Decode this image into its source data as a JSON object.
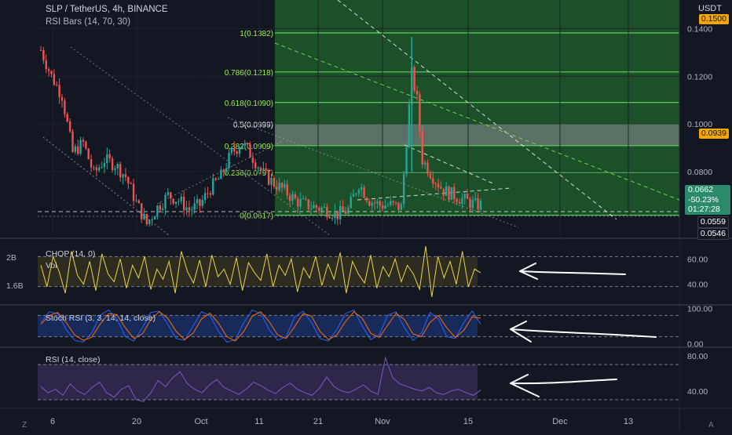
{
  "header": {
    "title": "SLP / TetherUS, 4h, BINANCE",
    "indicator": "RSI Bars (14, 70, 30)",
    "currency": "USDT"
  },
  "footer": {
    "left": "Z",
    "right": "A"
  },
  "colors": {
    "background": "#131722",
    "fib_zone": "#1d5b2a",
    "fib_line": "#4caf50",
    "candle_up": "#26a69a",
    "candle_down": "#ef5350",
    "chop_line": "#e8d54a",
    "stoch_k": "#2962ff",
    "stoch_d": "#ff6d00",
    "rsi_line": "#7e57c2",
    "tag_orange": "#f7a600",
    "tag_green": "#2a8a6b"
  },
  "price_tags": {
    "top": "0.1500",
    "current_marker": "0.0939",
    "last_price": "0.0662",
    "last_change": "-50.23%",
    "countdown": "01:27:28",
    "low_a": "0.0559",
    "low_b": "0.0546"
  },
  "chart_data": [
    {
      "type": "candlestick",
      "pane": "price",
      "title": "SLP / TetherUS, 4h, BINANCE",
      "y_axis": {
        "ticks": [
          "0.1400",
          "0.1200",
          "0.1000",
          "0.0800"
        ],
        "ylim": [
          0.054,
          0.152
        ]
      },
      "x_axis": {
        "ticks": [
          "6",
          "20",
          "Oct",
          "11",
          "21",
          "Nov",
          "15",
          "Dec",
          "13"
        ]
      },
      "fib_levels": [
        {
          "label": "1(0.1382)",
          "value": 0.1382
        },
        {
          "label": "0.786(0.1218)",
          "value": 0.1218
        },
        {
          "label": "0.618(0.1090)",
          "value": 0.109
        },
        {
          "label": "0.5(0.0999)",
          "value": 0.0999
        },
        {
          "label": "0.382(0.0909)",
          "value": 0.0909
        },
        {
          "label": "0.236(0.0797)",
          "value": 0.0797
        },
        {
          "label": "0(0.0617)",
          "value": 0.0617
        }
      ],
      "close_path": [
        [
          0,
          0.131
        ],
        [
          4,
          0.12
        ],
        [
          8,
          0.112
        ],
        [
          12,
          0.088
        ],
        [
          16,
          0.092
        ],
        [
          20,
          0.079
        ],
        [
          24,
          0.085
        ],
        [
          28,
          0.083
        ],
        [
          32,
          0.078
        ],
        [
          36,
          0.067
        ],
        [
          40,
          0.058
        ],
        [
          44,
          0.065
        ],
        [
          48,
          0.07
        ],
        [
          52,
          0.068
        ],
        [
          56,
          0.064
        ],
        [
          60,
          0.066
        ],
        [
          64,
          0.073
        ],
        [
          68,
          0.078
        ],
        [
          72,
          0.088
        ],
        [
          76,
          0.092
        ],
        [
          80,
          0.086
        ],
        [
          84,
          0.079
        ],
        [
          88,
          0.075
        ],
        [
          92,
          0.072
        ],
        [
          96,
          0.068
        ],
        [
          100,
          0.066
        ],
        [
          104,
          0.065
        ],
        [
          108,
          0.064
        ],
        [
          112,
          0.062
        ],
        [
          116,
          0.064
        ],
        [
          120,
          0.075
        ],
        [
          124,
          0.068
        ],
        [
          128,
          0.066
        ],
        [
          132,
          0.066
        ],
        [
          136,
          0.065
        ],
        [
          140,
          0.121
        ],
        [
          142,
          0.11
        ],
        [
          144,
          0.085
        ],
        [
          148,
          0.078
        ],
        [
          152,
          0.072
        ],
        [
          156,
          0.07
        ],
        [
          160,
          0.068
        ],
        [
          164,
          0.066
        ],
        [
          166,
          0.066
        ]
      ]
    },
    {
      "type": "line",
      "pane": "chop",
      "title": "CHOP (14, 0)",
      "subtitle": "Vol",
      "left_ticks": [
        "2B",
        "1.6B"
      ],
      "right_ticks": [
        "60.00",
        "40.00"
      ],
      "bands": [
        61.8,
        38.2
      ],
      "ylim": [
        25,
        75
      ],
      "values": [
        55,
        38,
        62,
        50,
        33,
        66,
        47,
        40,
        58,
        35,
        64,
        48,
        42,
        60,
        37,
        55,
        45,
        62,
        36,
        52,
        44,
        58,
        33,
        66,
        50,
        41,
        59,
        38,
        63,
        46,
        52,
        40,
        61,
        35,
        57,
        49,
        43,
        64,
        38,
        55,
        47,
        60,
        34,
        53,
        45,
        62,
        39,
        56,
        44,
        65,
        33,
        58,
        48,
        41,
        63,
        37,
        54,
        46,
        60,
        42,
        55,
        48,
        36,
        70,
        30,
        62,
        45,
        58,
        40,
        66,
        38,
        52,
        49
      ]
    },
    {
      "type": "line",
      "pane": "stoch",
      "title": "Stoch RSI (3, 3, 14, 14, close)",
      "right_ticks": [
        "100.00",
        "0.00"
      ],
      "bands": [
        80,
        20
      ],
      "ylim": [
        -5,
        105
      ],
      "series": [
        {
          "values": [
            60,
            90,
            85,
            40,
            10,
            5,
            30,
            80,
            95,
            70,
            20,
            8,
            45,
            88,
            92,
            55,
            15,
            10,
            50,
            90,
            80,
            35,
            5,
            12,
            60,
            95,
            85,
            40,
            10,
            20,
            75,
            92,
            60,
            15,
            8,
            40,
            85,
            95,
            50,
            12,
            25,
            80,
            90,
            45,
            10,
            30,
            88,
            70,
            20,
            15,
            60,
            92,
            55
          ]
        },
        {
          "values": [
            55,
            80,
            88,
            60,
            25,
            10,
            18,
            55,
            85,
            82,
            45,
            15,
            28,
            68,
            90,
            72,
            35,
            12,
            30,
            70,
            86,
            58,
            20,
            8,
            35,
            78,
            90,
            62,
            25,
            15,
            48,
            85,
            78,
            35,
            12,
            25,
            62,
            90,
            72,
            30,
            18,
            52,
            86,
            68,
            28,
            20,
            60,
            80,
            45,
            18,
            38,
            76,
            72
          ]
        }
      ]
    },
    {
      "type": "line",
      "pane": "rsi",
      "title": "RSI (14, close)",
      "right_ticks": [
        "80.00",
        "40.00"
      ],
      "bands": [
        70,
        30
      ],
      "ylim": [
        22,
        88
      ],
      "values": [
        45,
        38,
        42,
        35,
        48,
        40,
        36,
        44,
        50,
        38,
        33,
        42,
        46,
        30,
        28,
        38,
        52,
        45,
        55,
        62,
        48,
        42,
        38,
        47,
        53,
        44,
        40,
        36,
        42,
        50,
        46,
        41,
        37,
        44,
        49,
        42,
        38,
        35,
        43,
        56,
        45,
        40,
        38,
        42,
        47,
        40,
        36,
        78,
        55,
        48,
        45,
        42,
        40,
        44,
        38,
        36,
        40,
        42,
        38,
        35,
        41
      ]
    }
  ]
}
